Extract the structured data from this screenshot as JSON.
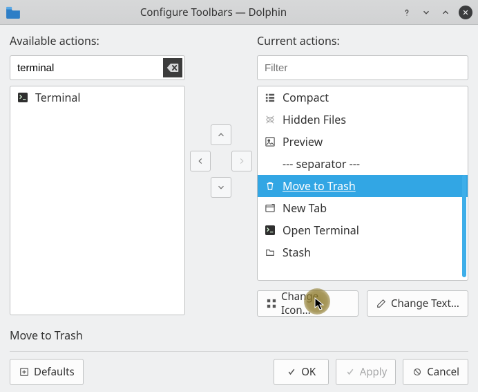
{
  "titlebar": {
    "title": "Configure Toolbars — Dolphin"
  },
  "left": {
    "heading": "Available actions:",
    "search_value": "terminal",
    "items": [
      {
        "label": "Terminal",
        "icon": "terminal-icon"
      }
    ]
  },
  "right": {
    "heading": "Current actions:",
    "filter_value": "",
    "filter_placeholder": "Filter",
    "items": [
      {
        "label": "Compact",
        "icon": "compact-icon",
        "selected": false
      },
      {
        "label": "Hidden Files",
        "icon": "hidden-icon",
        "selected": false
      },
      {
        "label": "Preview",
        "icon": "preview-icon",
        "selected": false
      },
      {
        "label": "--- separator ---",
        "icon": "",
        "selected": false
      },
      {
        "label": "Move to Trash",
        "icon": "trash-icon",
        "selected": true
      },
      {
        "label": "New Tab",
        "icon": "newtab-icon",
        "selected": false
      },
      {
        "label": "Open Terminal",
        "icon": "terminal-icon",
        "selected": false
      },
      {
        "label": "Stash",
        "icon": "stash-icon",
        "selected": false
      }
    ],
    "change_icon": "Change Icon...",
    "change_text": "Change Text..."
  },
  "status": {
    "selected_label": "Move to Trash"
  },
  "footer": {
    "defaults": "Defaults",
    "ok": "OK",
    "apply": "Apply",
    "cancel": "Cancel"
  }
}
